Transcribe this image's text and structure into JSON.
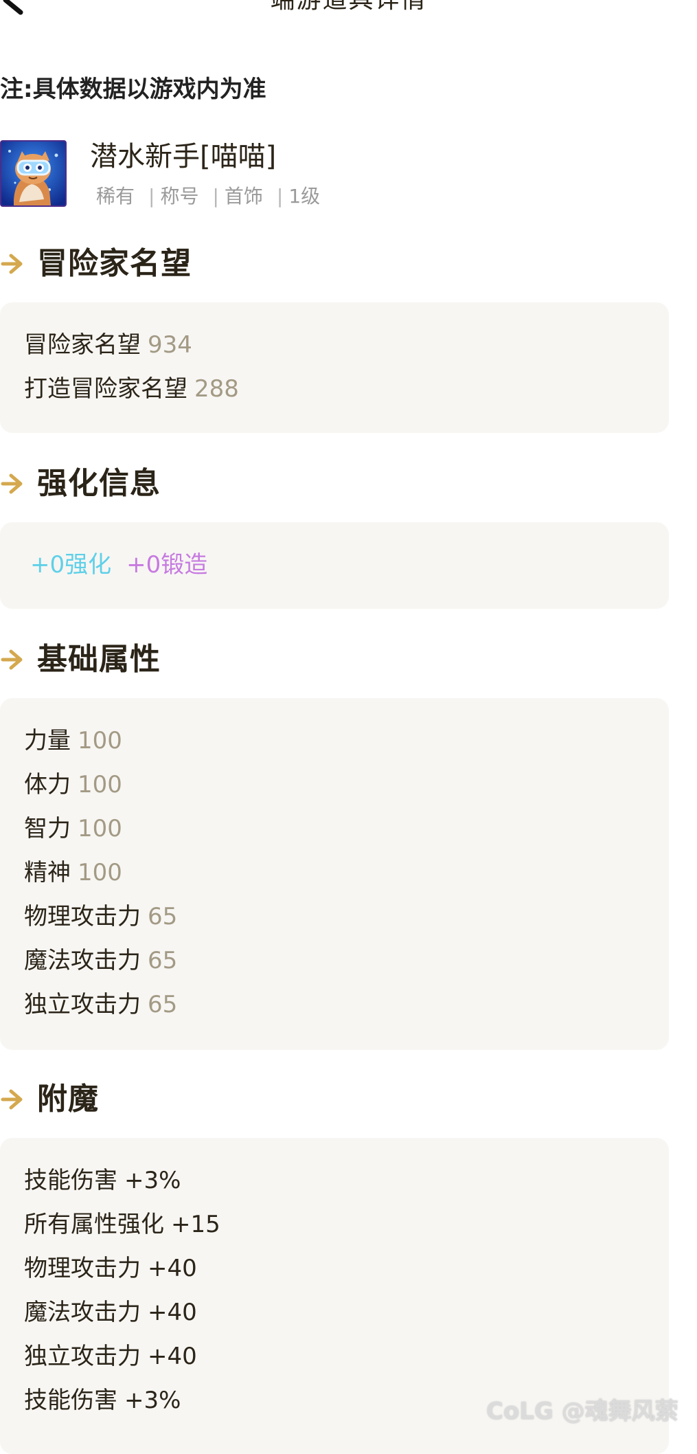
{
  "header": {
    "title": "端游道具详情"
  },
  "note": "注:具体数据以游戏内为准",
  "item": {
    "icon": "cat-diver-avatar-icon",
    "name": "潜水新手[喵喵]",
    "rarity": "稀有",
    "category": "称号",
    "slot": "首饰",
    "level": "1级"
  },
  "sections": {
    "reputation": {
      "title": "冒险家名望",
      "rows": [
        {
          "label": "冒险家名望",
          "value": "934"
        },
        {
          "label": "打造冒险家名望",
          "value": "288"
        }
      ]
    },
    "enhance": {
      "title": "强化信息",
      "enhance_label": "+0强化",
      "forge_label": "+0锻造"
    },
    "base_stats": {
      "title": "基础属性",
      "rows": [
        {
          "label": "力量",
          "value": "100"
        },
        {
          "label": "体力",
          "value": "100"
        },
        {
          "label": "智力",
          "value": "100"
        },
        {
          "label": "精神",
          "value": "100"
        },
        {
          "label": "物理攻击力",
          "value": "65"
        },
        {
          "label": "魔法攻击力",
          "value": "65"
        },
        {
          "label": "独立攻击力",
          "value": "65"
        }
      ]
    },
    "enchant": {
      "title": "附魔",
      "rows": [
        {
          "label": "技能伤害",
          "value": "+3%"
        },
        {
          "label": "所有属性强化",
          "value": "+15"
        },
        {
          "label": "物理攻击力",
          "value": "+40"
        },
        {
          "label": "魔法攻击力",
          "value": "+40"
        },
        {
          "label": "独立攻击力",
          "value": "+40"
        },
        {
          "label": "技能伤害",
          "value": "+3%"
        }
      ]
    }
  },
  "watermark": "CoLG @魂舞风萦",
  "colors": {
    "accent_gold": "#d4a84e",
    "value_tan": "#a39a85",
    "enhance_cyan": "#5fd0e8",
    "forge_purple": "#c77ae0",
    "card_bg": "#f7f6f3"
  }
}
